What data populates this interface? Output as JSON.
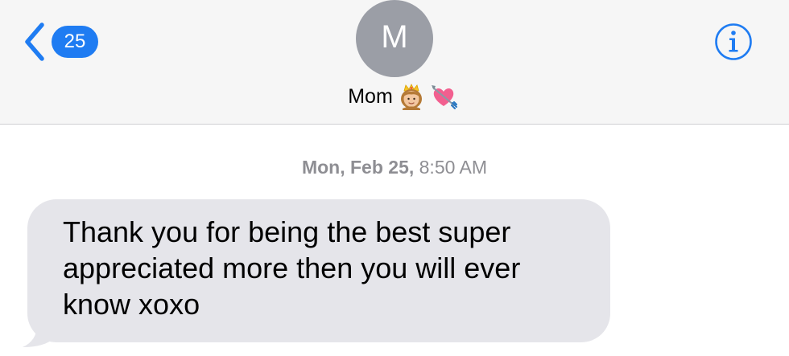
{
  "nav": {
    "back_badge_count": "25",
    "avatar_initial": "M",
    "contact_name": "Mom",
    "contact_emoji": [
      "princess-emoji",
      "heart-with-arrow-emoji"
    ],
    "info_icon": "info-icon"
  },
  "conversation": {
    "timestamp_day": "Mon, Feb 25,",
    "timestamp_time": " 8:50 AM",
    "messages": [
      {
        "direction": "incoming",
        "text": "Thank you for being the best super appreciated more then you will ever know xoxo"
      }
    ]
  },
  "colors": {
    "accent": "#1f7cf2",
    "avatar": "#9b9ea6",
    "incoming_bubble": "#e5e5ea",
    "nav_background": "#f6f6f6",
    "timestamp": "#8e8e93"
  }
}
